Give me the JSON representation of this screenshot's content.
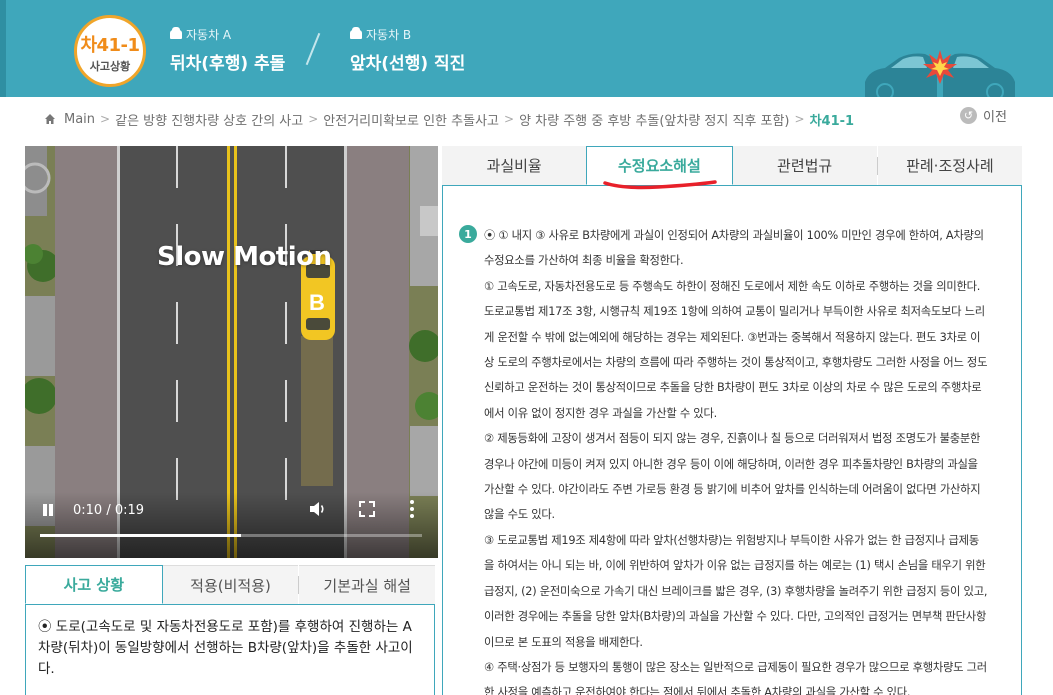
{
  "header": {
    "badge_code": "차41-1",
    "badge_label": "사고상황",
    "car_a_label": "자동차 A",
    "car_a_title": "뒤차(후행) 추돌",
    "car_b_label": "자동차 B",
    "car_b_title": "앞차(선행) 직진",
    "background_color": "#3fa7bb"
  },
  "breadcrumb": {
    "items": [
      "Main",
      "같은 방향 진행차량 상호 간의 사고",
      "안전거리미확보로 인한 추돌사고",
      "양 차량 주행 중 후방 추돌(앞차량 정지 직후 포함)"
    ],
    "separator": ">",
    "current": "차41-1",
    "prev_label": "이전"
  },
  "video": {
    "overlay_text": "Slow Motion",
    "car_label": "B",
    "time_display": "0:10 / 0:19",
    "progress": 0.526
  },
  "left_tabs": {
    "items": [
      "사고 상황",
      "적용(비적용)",
      "기본과실 해설"
    ],
    "active": 0
  },
  "left_panel": {
    "text": "⦿ 도로(고속도로 및 자동차전용도로 포함)를 후행하여 진행하는 A차량(뒤차)이 동일방향에서 선행하는 B차량(앞차)을 추돌한 사고이다."
  },
  "right_tabs": {
    "items": [
      "과실비율",
      "수정요소해설",
      "관련법규",
      "판례·조정사례"
    ],
    "active": 1
  },
  "explanation": {
    "number": "1",
    "paragraphs": [
      "⦿ ① 내지 ③ 사유로 B차량에게 과실이 인정되어 A차량의 과실비율이 100% 미만인 경우에 한하여, A차량의 수정요소를 가산하여 최종 비율을 확정한다.",
      "① 고속도로, 자동차전용도로 등 주행속도 하한이 정해진 도로에서 제한 속도 이하로 주행하는 것을 의미한다. 도로교통법 제17조 3항, 시행규칙 제19조 1항에 의하여 교통이 밀리거나 부득이한 사유로 최저속도보다 느리게 운전할 수 밖에 없는예외에 해당하는 경우는 제외된다. ③번과는 중복해서 적용하지 않는다. 편도 3차로 이상 도로의 주행차로에서는 차량의 흐름에 따라 주행하는 것이 통상적이고, 후행차량도 그러한 사정을 어느 정도 신뢰하고 운전하는 것이 통상적이므로 추돌을 당한 B차량이 편도 3차로 이상의 차로 수 많은 도로의 주행차로에서 이유 없이 정지한 경우 과실을 가산할 수 있다.",
      "② 제동등화에 고장이 생겨서 점등이 되지 않는 경우, 진흙이나 칠 등으로 더러워져서 법정 조명도가 불충분한 경우나 야간에 미등이 켜져 있지 아니한 경우 등이 이에 해당하며, 이러한 경우 피추돌차량인 B차량의 과실을 가산할 수 있다. 야간이라도 주변 가로등 환경 등 밝기에 비추어 앞차를 인식하는데 어려움이 없다면 가산하지 않을 수도 있다.",
      "③ 도로교통법 제19조 제4항에 따라 앞차(선행차량)는 위험방지나 부득이한 사유가 없는 한 급정지나 급제동을 하여서는 아니 되는 바, 이에 위반하여 앞차가 이유 없는 급정지를 하는 예로는 (1) 택시 손님을 태우기 위한 급정지, (2) 운전미숙으로 가속기 대신 브레이크를 밟은 경우, (3) 후행차량을 놀려주기 위한 급정지 등이 있고, 이러한 경우에는 추돌을 당한 앞차(B차량)의 과실을 가산할 수 있다. 다만, 고의적인 급정거는 면부책 판단사항이므로 본 도표의 적용을 배제한다.",
      "④ 주택·상점가 등 보행자의 통행이 많은 장소는 일반적으로 급제동이 필요한 경우가 많으므로 후행차량도 그러한 사정을 예측하고 운전하여야 한다는 점에서 뒤에서 추돌한 A차량의 과실을 가산할 수 있다."
    ]
  },
  "colors": {
    "accent": "#3aaa9c",
    "tab_border": "#3fa7bb",
    "annotation_red": "#e8202a",
    "car_yellow": "#f2c623"
  }
}
